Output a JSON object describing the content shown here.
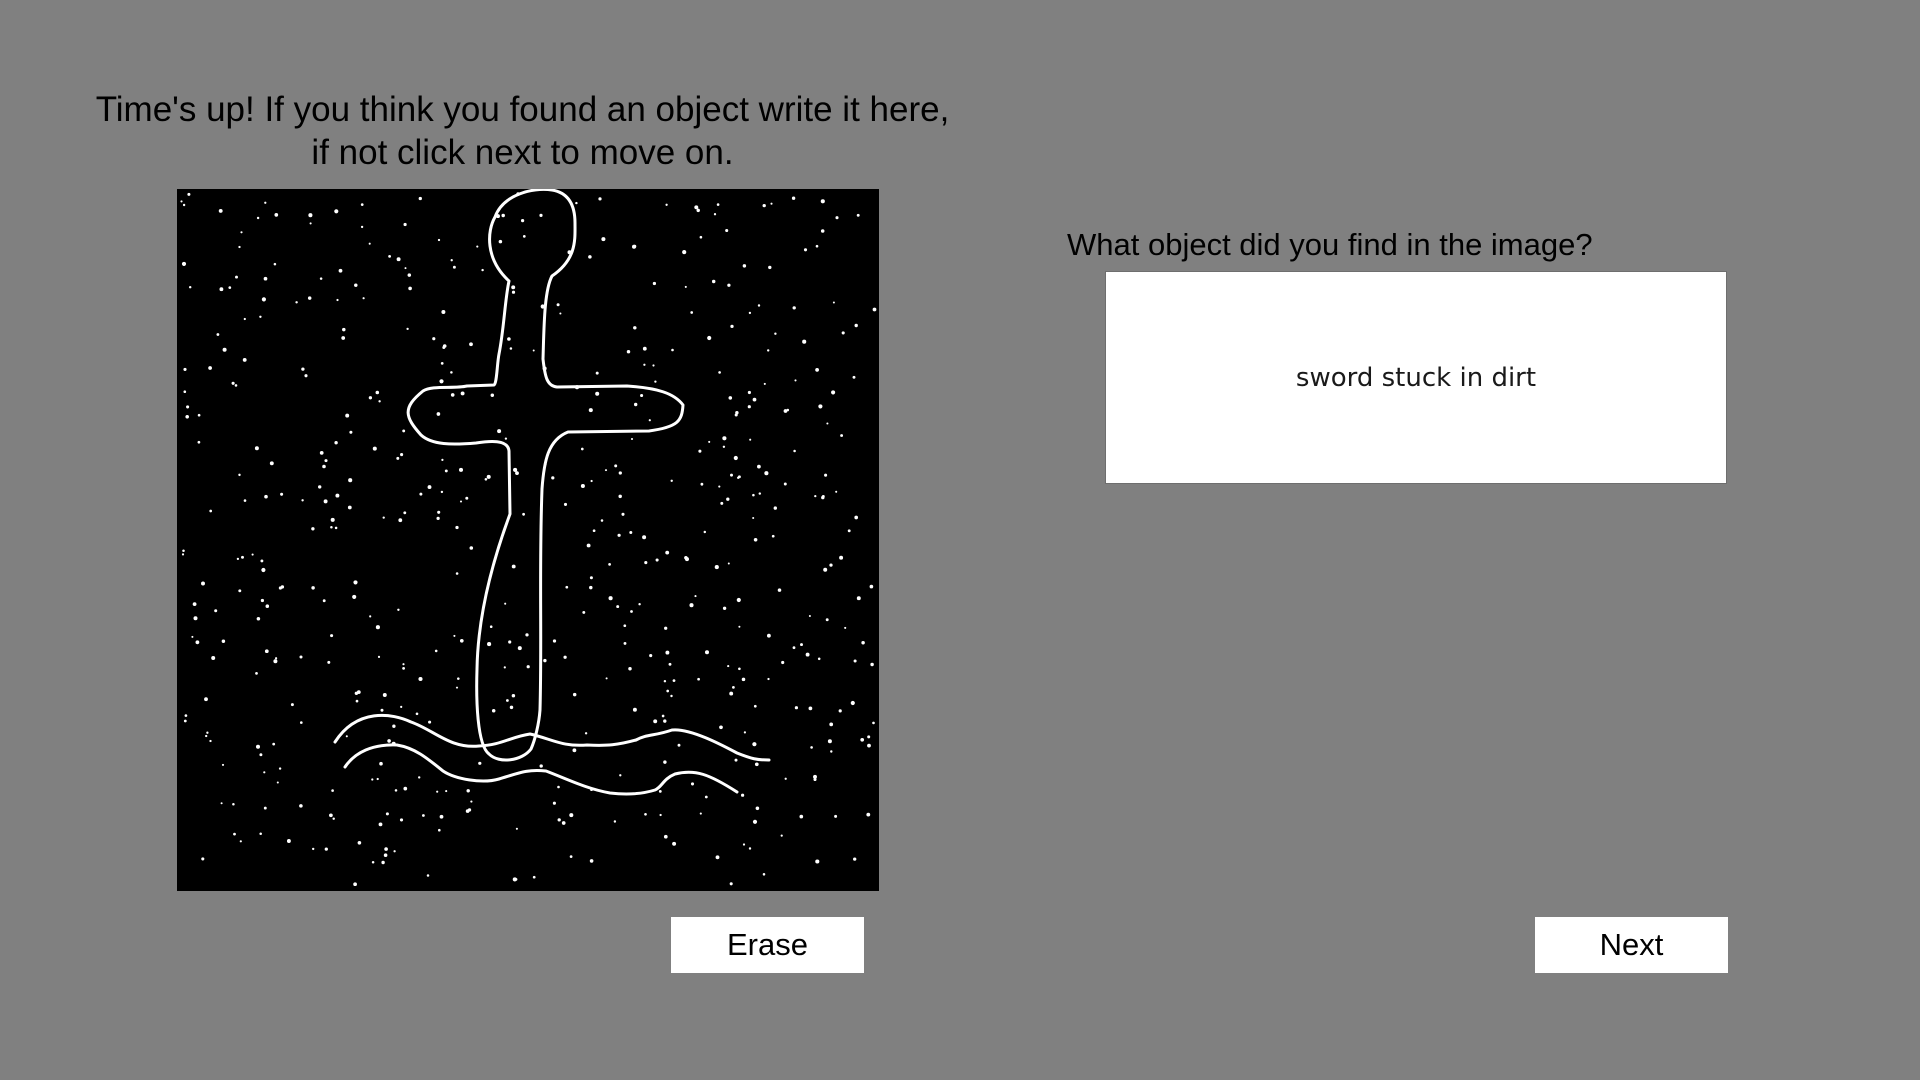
{
  "prompt": {
    "line1": "Time's up! If you think you found an object write it here,",
    "line2": "if not click next to move on."
  },
  "drawing_canvas": {
    "background_color": "#000000",
    "dot_color": "#ffffff",
    "stroke_color": "#ffffff",
    "drawing_subject": "sword stuck in dirt"
  },
  "question": {
    "label": "What object did you find in the image?"
  },
  "answer": {
    "value": "sword stuck in dirt",
    "placeholder": ""
  },
  "buttons": {
    "erase_label": "Erase",
    "next_label": "Next"
  },
  "colors": {
    "page_background": "#808080",
    "button_background": "#ffffff",
    "text": "#000000"
  }
}
